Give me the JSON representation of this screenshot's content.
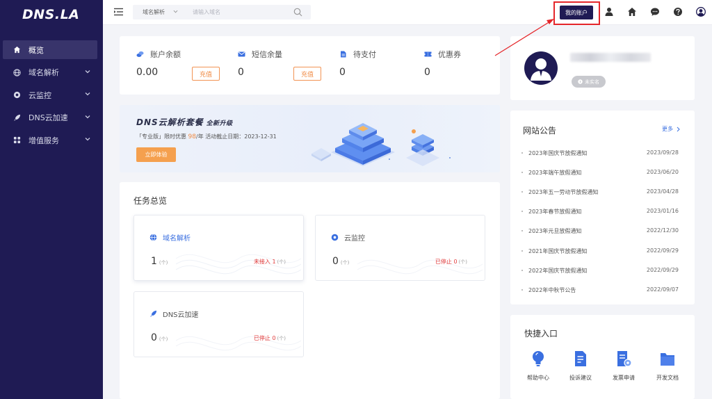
{
  "app": {
    "logo": "DNS.LA"
  },
  "sidebar": {
    "items": [
      {
        "label": "概览",
        "icon": "home-icon",
        "active": true
      },
      {
        "label": "域名解析",
        "icon": "globe-icon"
      },
      {
        "label": "云监控",
        "icon": "monitor-icon"
      },
      {
        "label": "DNS云加速",
        "icon": "rocket-icon"
      },
      {
        "label": "增值服务",
        "icon": "apps-icon"
      }
    ]
  },
  "topbar": {
    "search_type": "域名解析",
    "search_placeholder": "请输入域名",
    "account_button": "我的账户",
    "icons": [
      "user-icon",
      "home-icon",
      "chat-icon",
      "help-icon",
      "avatar-icon"
    ]
  },
  "stats": [
    {
      "label": "账户余额",
      "value": "0.00",
      "button": "充值",
      "icon": "wallet-icon"
    },
    {
      "label": "短信余量",
      "value": "0",
      "button": "充值",
      "icon": "mail-icon"
    },
    {
      "label": "待支付",
      "value": "0",
      "icon": "document-icon"
    },
    {
      "label": "优惠券",
      "value": "0",
      "icon": "coupon-icon"
    }
  ],
  "banner": {
    "title": "DNS云解析套餐",
    "subtitle": "全新升级",
    "desc_prefix": "「专业版」限时优惠 ",
    "price": "98",
    "desc_suffix": "/年    活动截止日期：2023-12-31",
    "button": "立即体验"
  },
  "tasks": {
    "title": "任务总览",
    "items": [
      {
        "name": "域名解析",
        "count": "1",
        "unit": "(个)",
        "status_label": "未接入",
        "status_count": "1",
        "status_unit": "(个)",
        "icon": "globe-icon"
      },
      {
        "name": "云监控",
        "count": "0",
        "unit": "(个)",
        "status_label": "已停止",
        "status_count": "0",
        "status_unit": "(个)",
        "icon": "monitor-icon"
      },
      {
        "name": "DNS云加速",
        "count": "0",
        "unit": "(个)",
        "status_label": "已停止",
        "status_count": "0",
        "status_unit": "(个)",
        "icon": "rocket-icon"
      }
    ]
  },
  "profile": {
    "badge": "未实名"
  },
  "notices": {
    "title": "网站公告",
    "more": "更多",
    "items": [
      {
        "text": "2023年国庆节放假通知",
        "date": "2023/09/28"
      },
      {
        "text": "2023年端午放假通知",
        "date": "2023/06/20"
      },
      {
        "text": "2023年五一劳动节放假通知",
        "date": "2023/04/28"
      },
      {
        "text": "2023年春节放假通知",
        "date": "2023/01/16"
      },
      {
        "text": "2023年元旦放假通知",
        "date": "2022/12/30"
      },
      {
        "text": "2021年国庆节放假通知",
        "date": "2022/09/29"
      },
      {
        "text": "2022年国庆节放假通知",
        "date": "2022/09/29"
      },
      {
        "text": "2022年中秋节公告",
        "date": "2022/09/07"
      }
    ]
  },
  "quick": {
    "title": "快捷入口",
    "items": [
      {
        "label": "帮助中心",
        "icon": "lightbulb-icon"
      },
      {
        "label": "投诉建议",
        "icon": "feedback-icon"
      },
      {
        "label": "发票申请",
        "icon": "invoice-icon"
      },
      {
        "label": "开发文档",
        "icon": "folder-icon"
      }
    ]
  },
  "colors": {
    "sidebar_bg": "#1f1b54",
    "accent_orange": "#f08b45",
    "accent_blue": "#3a6fe0",
    "alert_red": "#e5262a"
  }
}
